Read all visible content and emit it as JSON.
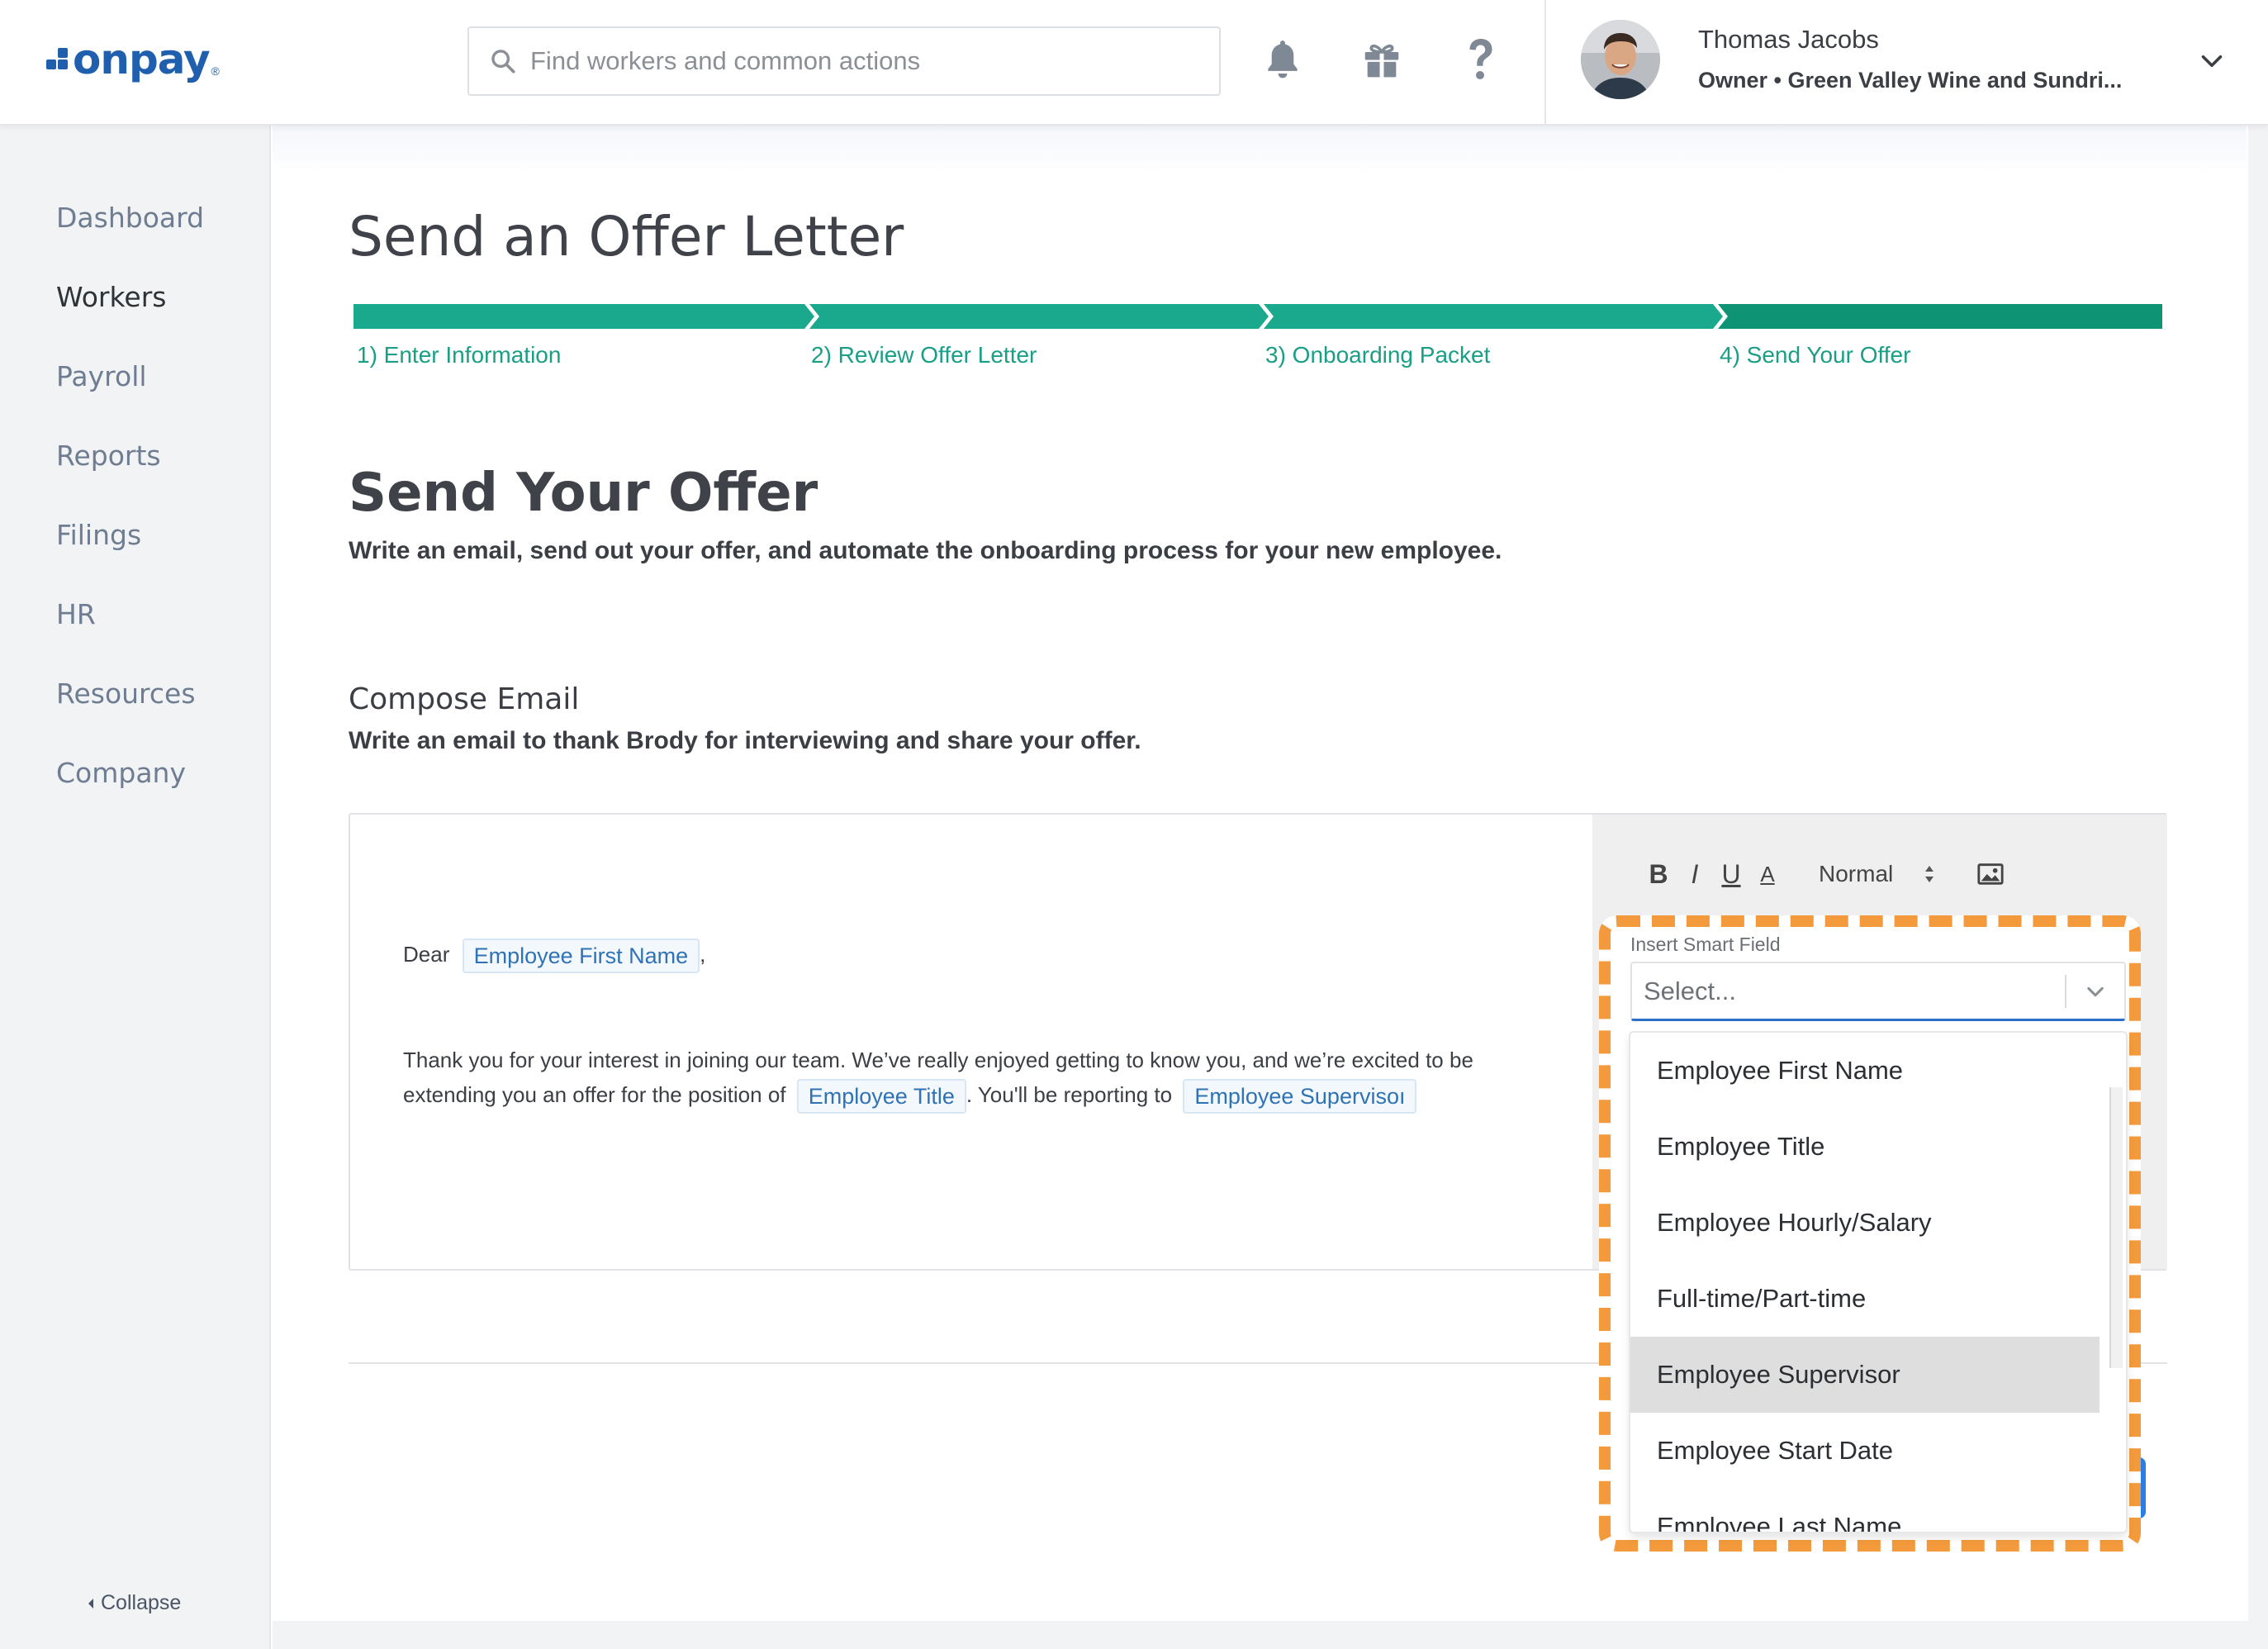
{
  "header": {
    "logo_text": "onpay",
    "logo_mark": "®",
    "search_placeholder": "Find workers and common actions",
    "icons": [
      "bell-icon",
      "gift-icon",
      "help-icon"
    ],
    "user": {
      "name": "Thomas Jacobs",
      "role": "Owner • Green Valley Wine and Sundri..."
    }
  },
  "sidebar": {
    "items": [
      {
        "label": "Dashboard",
        "active": false
      },
      {
        "label": "Workers",
        "active": true
      },
      {
        "label": "Payroll",
        "active": false
      },
      {
        "label": "Reports",
        "active": false
      },
      {
        "label": "Filings",
        "active": false
      },
      {
        "label": "HR",
        "active": false
      },
      {
        "label": "Resources",
        "active": false
      },
      {
        "label": "Company",
        "active": false
      }
    ],
    "collapse_label": "Collapse"
  },
  "page": {
    "title": "Send an Offer Letter",
    "steps": [
      {
        "label": "1) Enter Information"
      },
      {
        "label": "2) Review Offer Letter"
      },
      {
        "label": "3) Onboarding Packet"
      },
      {
        "label": "4) Send Your Offer"
      }
    ],
    "section_title": "Send Your Offer",
    "section_subtitle": "Write an email, send out your offer, and automate the onboarding process for your new employee.",
    "compose_title": "Compose Email",
    "compose_subtitle": "Write an email to thank Brody for interviewing and share your offer."
  },
  "editor": {
    "greeting": "Dear",
    "greeting_chip": "Employee First Name",
    "greeting_comma": ",",
    "body_line1": "Thank you for your interest in joining our team. We’ve really enjoyed getting to know you, and we’re excited to be",
    "body_line2_pre": "extending you an offer for the position of",
    "chip_title": "Employee Title",
    "body_line2_mid": ". You'll be reporting to",
    "chip_supervisor": "Employee Supervisoı",
    "toolbar": {
      "bold": "B",
      "italic": "I",
      "underline": "U",
      "color": "A",
      "format_value": "Normal"
    }
  },
  "smart_field": {
    "label": "Insert Smart Field",
    "placeholder": "Select...",
    "options": [
      "Employee First Name",
      "Employee Title",
      "Employee Hourly/Salary",
      "Full-time/Part-time",
      "Employee Supervisor",
      "Employee Start Date",
      "Employee Last Name"
    ],
    "hovered": "Employee Supervisor"
  },
  "colors": {
    "brand": "#1f5fae",
    "progress": "#1aa98d",
    "progress_active": "#0e9474",
    "step_text": "#1a9e86",
    "highlight": "#f39a3c",
    "chip_text": "#2f72b5"
  }
}
